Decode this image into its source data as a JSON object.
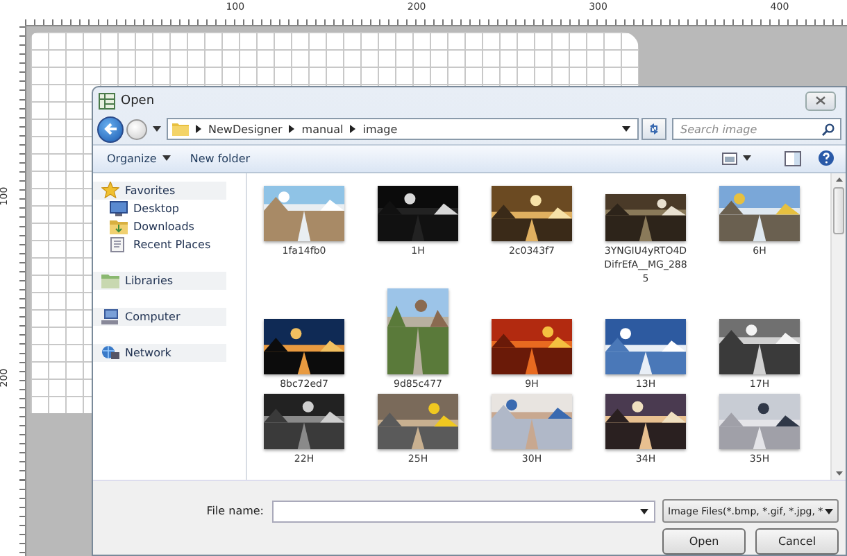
{
  "ruler": {
    "top_labels": [
      "100",
      "200",
      "300",
      "400"
    ],
    "left_labels": [
      "100",
      "200"
    ]
  },
  "dialog": {
    "title": "Open",
    "path": [
      "NewDesigner",
      "manual",
      "image"
    ],
    "search": {
      "placeholder": "Search image"
    },
    "toolbar": {
      "organize": "Organize",
      "new_folder": "New folder"
    },
    "sidebar": [
      {
        "label": "Favorites",
        "children": [
          {
            "label": "Desktop"
          },
          {
            "label": "Downloads"
          },
          {
            "label": "Recent Places"
          }
        ]
      },
      {
        "label": "Libraries"
      },
      {
        "label": "Computer"
      },
      {
        "label": "Network"
      }
    ],
    "files": [
      {
        "name": "1fa14fb0",
        "kind": "picture"
      },
      {
        "name": "1H",
        "kind": "picture"
      },
      {
        "name": "2c0343f7",
        "kind": "picture"
      },
      {
        "name": "3YNGIU4yRTO4DDifrEfA__MG_2885",
        "kind": "picture"
      },
      {
        "name": "6H",
        "kind": "picture"
      },
      {
        "name": "8bc72ed7",
        "kind": "picture"
      },
      {
        "name": "9d85c477",
        "kind": "picture"
      },
      {
        "name": "9H",
        "kind": "picture"
      },
      {
        "name": "13H",
        "kind": "picture"
      },
      {
        "name": "17H",
        "kind": "picture"
      },
      {
        "name": "22H",
        "kind": "picture"
      },
      {
        "name": "25H",
        "kind": "picture"
      },
      {
        "name": "30H",
        "kind": "picture"
      },
      {
        "name": "34H",
        "kind": "picture"
      },
      {
        "name": "35H",
        "kind": "picture"
      }
    ],
    "file_name": {
      "label": "File name:"
    },
    "file_type": "Image Files(*.bmp, *.gif, *.jpg, *",
    "buttons": [
      "Open",
      "Cancel"
    ]
  }
}
